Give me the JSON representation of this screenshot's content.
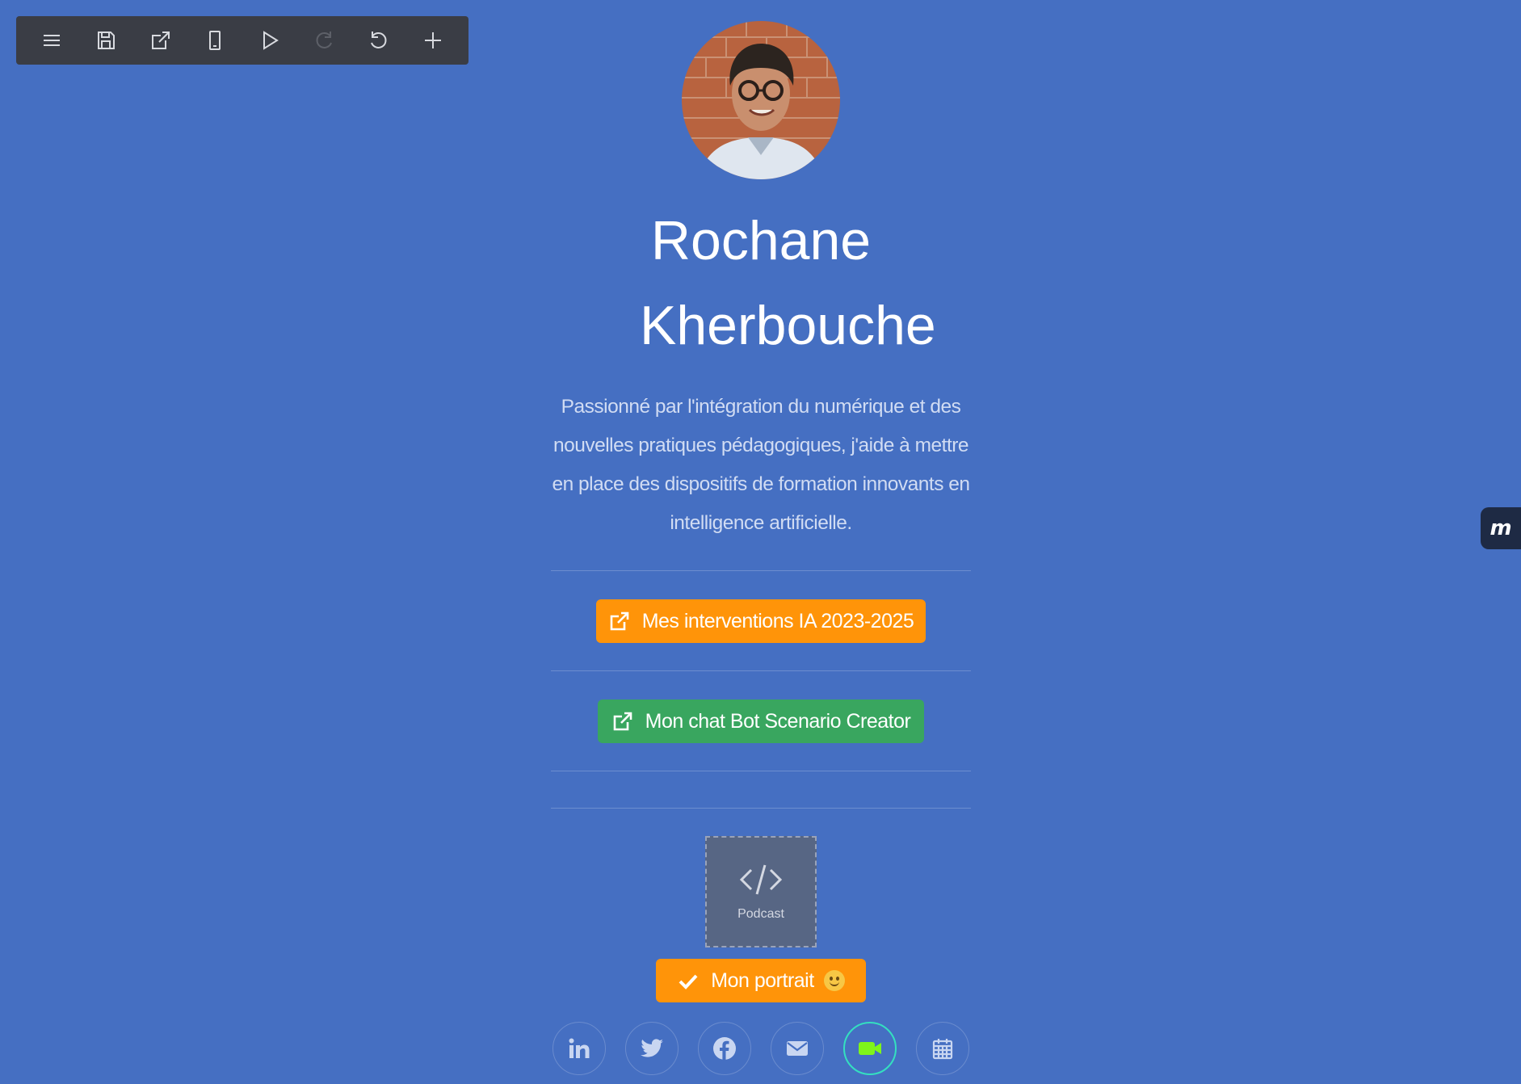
{
  "toolbar": {
    "items": [
      "menu-icon",
      "save-icon",
      "open-external-icon",
      "mobile-preview-icon",
      "play-icon",
      "redo-icon",
      "undo-icon",
      "plus-icon"
    ]
  },
  "profile": {
    "name": "Rochane Kherbouche",
    "bio": "Passionné par l'intégration du numérique et des nouvelles pratiques pédagogiques, j'aide à mettre en place des dispositifs de formation innovants en intelligence artificielle."
  },
  "buttons": {
    "interventions": "Mes interventions IA 2023-2025",
    "chatbot": "Mon chat Bot Scenario Creator",
    "portrait": "Mon portrait"
  },
  "embed": {
    "label": "Podcast"
  },
  "side_badge": {
    "label": "m"
  },
  "socials": [
    "linkedin-icon",
    "twitter-icon",
    "facebook-icon",
    "email-icon",
    "video-icon",
    "calendar-icon"
  ],
  "colors": {
    "background": "#456fc2",
    "orange": "#ff9409",
    "green": "#39a65f",
    "toolbar": "#3a3d45",
    "video_accent": "#7ff51a"
  }
}
